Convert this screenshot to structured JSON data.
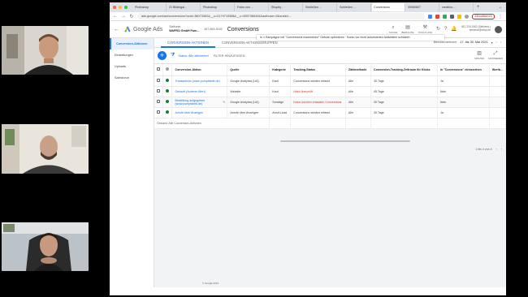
{
  "browser": {
    "tabs": [
      {
        "label": "Photoshop",
        "active": false
      },
      {
        "label": "21 Bildergal...",
        "active": false
      },
      {
        "label": "Photoshop",
        "active": false
      },
      {
        "label": "Fotos von ...",
        "active": false
      },
      {
        "label": "Shopify...",
        "active": false
      },
      {
        "label": "Schließen ...",
        "active": false
      },
      {
        "label": "Schließen ...",
        "active": false
      },
      {
        "label": "Conversions",
        "active": true
      },
      {
        "label": "09080607",
        "active": false
      },
      {
        "label": "creation-...",
        "active": false
      }
    ],
    "url": "ads.google.com/aw/conversions?ocid=36073362&__u=2179715368&__c=3957366344&authuser=0&subid=...",
    "update_label": "Aktualisieren"
  },
  "ads": {
    "brand": "Google Ads",
    "account_line1": "Stellvertr.",
    "account_line2": "WAPRO GmbH Pum...",
    "account_id": "457-863-9152",
    "page_title": "Conversions",
    "tools": [
      {
        "icon": "search-icon",
        "glyph": "⌕",
        "label": "SUCHE"
      },
      {
        "icon": "report-icon",
        "glyph": "▤",
        "label": "BERICHTE"
      },
      {
        "icon": "tools-icon",
        "glyph": "⚒",
        "label": "TOOLS UND"
      },
      {
        "icon": "refresh-icon",
        "glyph": "↻",
        "label": ""
      },
      {
        "icon": "help-icon",
        "glyph": "?",
        "label": ""
      },
      {
        "icon": "bell-icon",
        "glyph": "🔔",
        "label": ""
      }
    ],
    "user_line1": "457-218-1962 (Stellvertr.)",
    "user_line2": "benanor@mbpi.de"
  },
  "notice": "In 1 Kampagne mit \"Conversions maximieren\" Gebote optimieren  ·  Konto vor nicht autorisierten Aktivitäten schützen",
  "sidenav": [
    {
      "label": "Conversion-Aktionen",
      "active": true
    },
    {
      "label": "Einstellungen",
      "active": false
    },
    {
      "label": "Uploads",
      "active": false
    },
    {
      "label": "Salesforce",
      "active": false
    }
  ],
  "subtabs": [
    {
      "label": "Conversion-Aktionen",
      "active": true
    },
    {
      "label": "Conversion-Aktionsgruppen",
      "active": false
    }
  ],
  "daterange": {
    "label": "Benutzerdefiniert",
    "value": "17. bis 30. Mai 2021"
  },
  "toolbar": {
    "filter_status": "Status: Alle aktivierten",
    "filter_add": "FILTER HINZUFÜGEN",
    "columns_label": "SPALTEN",
    "expand_label": "MAXIMIEREN"
  },
  "table": {
    "headers": [
      "Conversion-Aktion",
      "Quelle",
      "Kategorie",
      "Tracking-Status",
      "Zählmethode",
      "Conversion-Tracking-Zeitraum für Klicks",
      "In \"Conversions\" einbeziehen",
      "Wertb..."
    ],
    "rows": [
      {
        "name": "Transactions (www.pumpfabrik.de)",
        "source": "Google Analytics (UA)",
        "category": "Kauf",
        "status": "Conversions werden erfasst",
        "status_warn": false,
        "count": "Alle",
        "window": "30 Tage",
        "include": "Ja",
        "highlight": false
      },
      {
        "name": "Gekauft (Anderer Wert)",
        "source": "Website",
        "category": "Kauf",
        "status": "Nicht überprüft",
        "status_warn": true,
        "count": "Alle",
        "window": "45 Tage",
        "include": "Nein",
        "highlight": false
      },
      {
        "name": "Bestellung aufgegeben (www.pumpfabrik.de)",
        "source": "Google Analytics (UA)",
        "category": "Sonstige",
        "status": "Keine kürzlich erfassten Conversions",
        "status_warn": true,
        "count": "Alle",
        "window": "30 Tage",
        "include": "Nein",
        "highlight": true
      },
      {
        "name": "Anrufe über Anzeigen",
        "source": "Anrufe über Anzeigen",
        "category": "Anruf-Lead",
        "status": "Conversions werden erfasst",
        "status_warn": false,
        "count": "Alle",
        "window": "30 Tage",
        "include": "Ja",
        "highlight": false
      }
    ],
    "total": "Gesamt: Alle Conversion-Aktionen"
  },
  "pager": "1 bis 4 von 4",
  "footer": "© Google 2021"
}
